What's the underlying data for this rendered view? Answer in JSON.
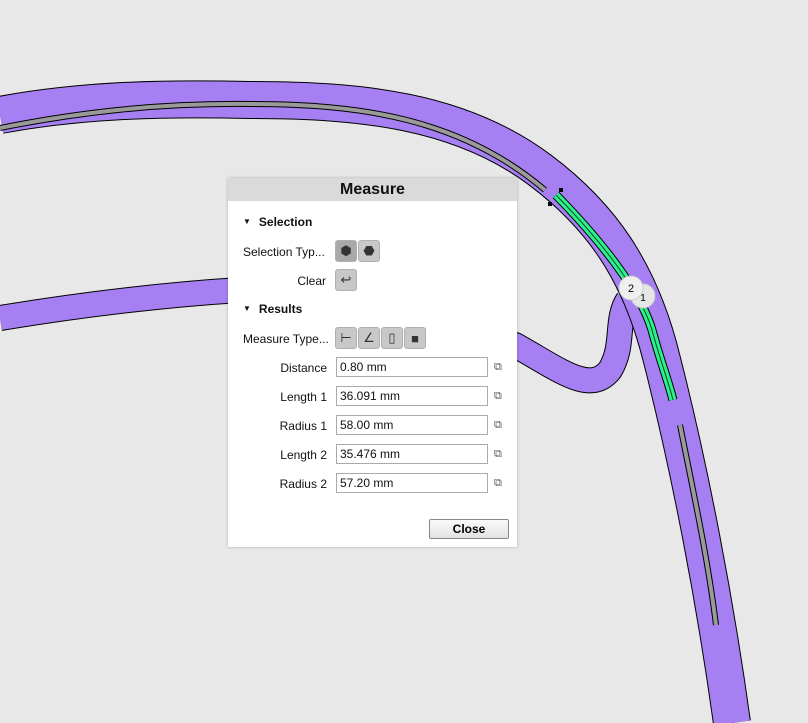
{
  "dialog": {
    "title": "Measure",
    "close_label": "Close"
  },
  "selection": {
    "heading": "Selection",
    "type_label": "Selection Typ...",
    "clear_label": "Clear"
  },
  "results": {
    "heading": "Results",
    "type_label": "Measure Type...",
    "rows": [
      {
        "label": "Distance",
        "value": "0.80 mm"
      },
      {
        "label": "Length 1",
        "value": "36.091 mm"
      },
      {
        "label": "Radius 1",
        "value": "58.00 mm"
      },
      {
        "label": "Length 2",
        "value": "35.476 mm"
      },
      {
        "label": "Radius 2",
        "value": "57.20 mm"
      }
    ]
  },
  "markers": [
    "2",
    "1"
  ],
  "colors": {
    "part": "#a680f3",
    "highlight": "#2ef08a",
    "background": "#e8e8e8"
  }
}
